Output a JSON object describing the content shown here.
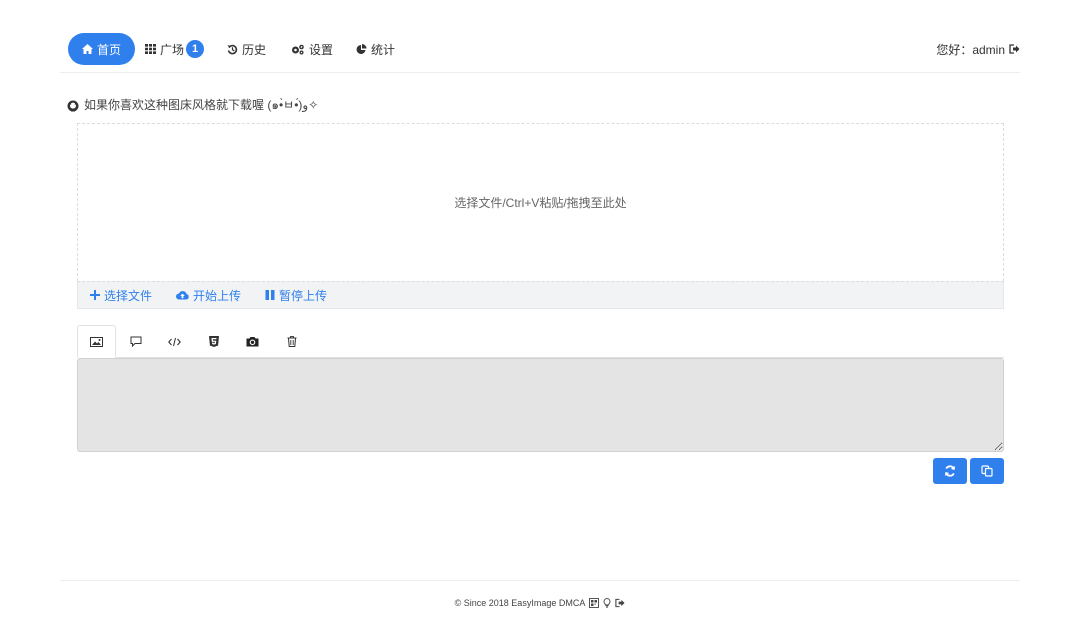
{
  "nav": {
    "items": [
      {
        "label": "首页",
        "icon": "home-icon",
        "active": true
      },
      {
        "label": "广场",
        "icon": "grid-icon",
        "badge": "1"
      },
      {
        "label": "历史",
        "icon": "history-icon"
      },
      {
        "label": "设置",
        "icon": "gears-icon"
      },
      {
        "label": "统计",
        "icon": "pie-chart-icon"
      }
    ],
    "user_greeting": "您好：admin",
    "accent_color": "#2f80ed"
  },
  "notice": {
    "text": "如果你喜欢这种图床风格就下载喔 (๑•̀ㅂ•́)و✧",
    "icon": "github-icon"
  },
  "dropzone": {
    "hint": "选择文件/Ctrl+V粘贴/拖拽至此处"
  },
  "upload_actions": {
    "select": "选择文件",
    "start": "开始上传",
    "pause": "暂停上传"
  },
  "tabs": [
    {
      "icon": "image-icon",
      "active": true
    },
    {
      "icon": "comment-icon"
    },
    {
      "icon": "code-icon"
    },
    {
      "icon": "html5-icon"
    },
    {
      "icon": "camera-icon"
    },
    {
      "icon": "trash-icon"
    }
  ],
  "output": {
    "value": ""
  },
  "footer": {
    "text": "© Since 2018 EasyImage DMCA"
  }
}
